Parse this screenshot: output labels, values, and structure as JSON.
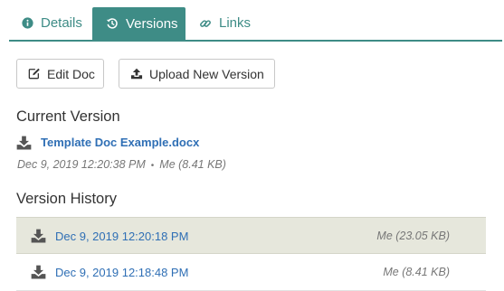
{
  "tabs": [
    {
      "label": "Details",
      "icon": "info-circle-icon"
    },
    {
      "label": "Versions",
      "icon": "history-icon"
    },
    {
      "label": "Links",
      "icon": "link-icon"
    }
  ],
  "actions": {
    "edit_label": "Edit Doc",
    "upload_label": "Upload New Version"
  },
  "current_version": {
    "heading": "Current Version",
    "file_name": "Template Doc Example.docx",
    "date": "Dec 9, 2019 12:20:38 PM",
    "separator": "•",
    "meta": "Me (8.41 KB)"
  },
  "history": {
    "heading": "Version History",
    "rows": [
      {
        "date": "Dec 9, 2019 12:20:18 PM",
        "meta": "Me (23.05 KB)"
      },
      {
        "date": "Dec 9, 2019 12:18:48 PM",
        "meta": "Me (8.41 KB)"
      }
    ]
  },
  "colors": {
    "accent": "#3e8c86",
    "link": "#2f6fb5",
    "highlight_row": "#e6e7dc"
  }
}
